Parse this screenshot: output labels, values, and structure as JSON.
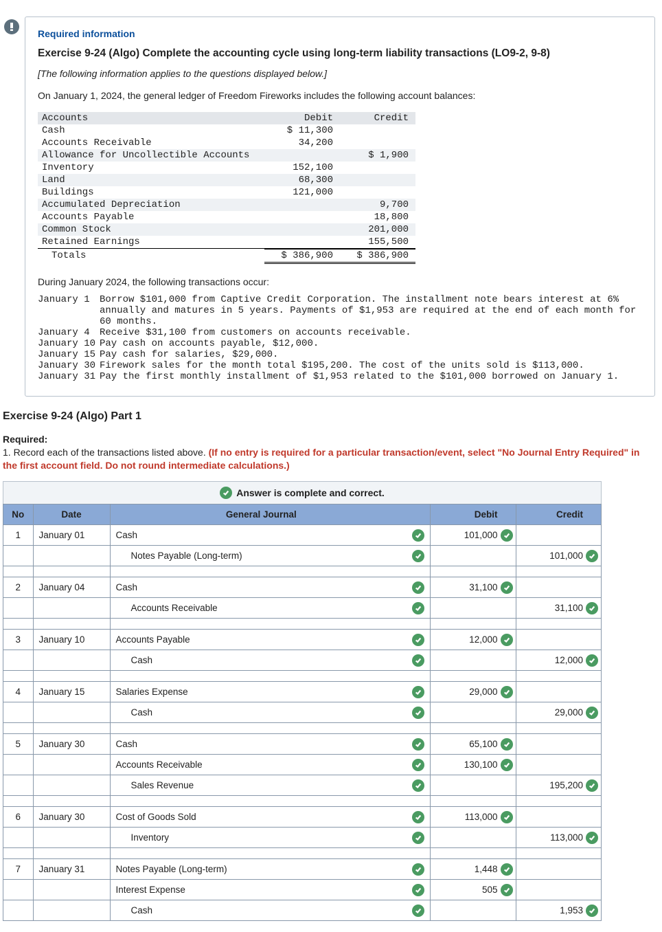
{
  "header": {
    "required_info": "Required information",
    "exercise_title": "Exercise 9-24 (Algo) Complete the accounting cycle using long-term liability transactions (LO9-2, 9-8)",
    "italic_intro": "[The following information applies to the questions displayed below.]",
    "intro_line": "On January 1, 2024, the general ledger of Freedom Fireworks includes the following account balances:"
  },
  "ledger": {
    "headers": {
      "accounts": "Accounts",
      "debit": "Debit",
      "credit": "Credit"
    },
    "rows": [
      {
        "acct": "Cash",
        "debit": "$ 11,300",
        "credit": ""
      },
      {
        "acct": "Accounts Receivable",
        "debit": "34,200",
        "credit": ""
      },
      {
        "acct": "Allowance for Uncollectible Accounts",
        "debit": "",
        "credit": "$ 1,900"
      },
      {
        "acct": "Inventory",
        "debit": "152,100",
        "credit": ""
      },
      {
        "acct": "Land",
        "debit": "68,300",
        "credit": ""
      },
      {
        "acct": "Buildings",
        "debit": "121,000",
        "credit": ""
      },
      {
        "acct": "Accumulated Depreciation",
        "debit": "",
        "credit": "9,700"
      },
      {
        "acct": "Accounts Payable",
        "debit": "",
        "credit": "18,800"
      },
      {
        "acct": "Common Stock",
        "debit": "",
        "credit": "201,000"
      },
      {
        "acct": "Retained Earnings",
        "debit": "",
        "credit": "155,500"
      }
    ],
    "totals": {
      "label": "Totals",
      "debit": "$ 386,900",
      "credit": "$ 386,900"
    }
  },
  "narrative": "During January 2024, the following transactions occur:",
  "transactions": [
    {
      "date": "January 1",
      "text": "Borrow $101,000 from Captive Credit Corporation. The installment note bears interest at 6% annually and matures in 5 years. Payments of $1,953 are required at the end of each month for 60 months."
    },
    {
      "date": "January 4",
      "text": "Receive $31,100 from customers on accounts receivable."
    },
    {
      "date": "January 10",
      "text": "Pay cash on accounts payable, $12,000."
    },
    {
      "date": "January 15",
      "text": "Pay cash for salaries, $29,000."
    },
    {
      "date": "January 30",
      "text": "Firework sales for the month total $195,200. The cost of the units sold is $113,000."
    },
    {
      "date": "January 31",
      "text": "Pay the first monthly installment of $1,953 related to the $101,000 borrowed on January 1."
    }
  ],
  "part": {
    "title": "Exercise 9-24 (Algo) Part 1",
    "required_label": "Required:",
    "body_prefix": "1. Record each of the transactions listed above. ",
    "body_red": "(If no entry is required for a particular transaction/event, select \"No Journal Entry Required\" in the first account field. Do not round intermediate calculations.)"
  },
  "answer_banner": "Answer is complete and correct.",
  "journal_headers": {
    "no": "No",
    "date": "Date",
    "gj": "General Journal",
    "debit": "Debit",
    "credit": "Credit"
  },
  "journal": [
    {
      "no": "1",
      "date": "January 01",
      "lines": [
        {
          "acct": "Cash",
          "indent": 0,
          "debit": "101,000",
          "credit": ""
        },
        {
          "acct": "Notes Payable (Long-term)",
          "indent": 1,
          "debit": "",
          "credit": "101,000"
        }
      ]
    },
    {
      "no": "2",
      "date": "January 04",
      "lines": [
        {
          "acct": "Cash",
          "indent": 0,
          "debit": "31,100",
          "credit": ""
        },
        {
          "acct": "Accounts Receivable",
          "indent": 1,
          "debit": "",
          "credit": "31,100"
        }
      ]
    },
    {
      "no": "3",
      "date": "January 10",
      "lines": [
        {
          "acct": "Accounts Payable",
          "indent": 0,
          "debit": "12,000",
          "credit": ""
        },
        {
          "acct": "Cash",
          "indent": 1,
          "debit": "",
          "credit": "12,000"
        }
      ]
    },
    {
      "no": "4",
      "date": "January 15",
      "lines": [
        {
          "acct": "Salaries Expense",
          "indent": 0,
          "debit": "29,000",
          "credit": ""
        },
        {
          "acct": "Cash",
          "indent": 1,
          "debit": "",
          "credit": "29,000"
        }
      ]
    },
    {
      "no": "5",
      "date": "January 30",
      "lines": [
        {
          "acct": "Cash",
          "indent": 0,
          "debit": "65,100",
          "credit": ""
        },
        {
          "acct": "Accounts Receivable",
          "indent": 0,
          "debit": "130,100",
          "credit": ""
        },
        {
          "acct": "Sales Revenue",
          "indent": 1,
          "debit": "",
          "credit": "195,200"
        }
      ]
    },
    {
      "no": "6",
      "date": "January 30",
      "lines": [
        {
          "acct": "Cost of Goods Sold",
          "indent": 0,
          "debit": "113,000",
          "credit": ""
        },
        {
          "acct": "Inventory",
          "indent": 1,
          "debit": "",
          "credit": "113,000"
        }
      ]
    },
    {
      "no": "7",
      "date": "January 31",
      "lines": [
        {
          "acct": "Notes Payable (Long-term)",
          "indent": 0,
          "debit": "1,448",
          "credit": ""
        },
        {
          "acct": "Interest Expense",
          "indent": 0,
          "debit": "505",
          "credit": ""
        },
        {
          "acct": "Cash",
          "indent": 1,
          "debit": "",
          "credit": "1,953"
        }
      ]
    }
  ]
}
